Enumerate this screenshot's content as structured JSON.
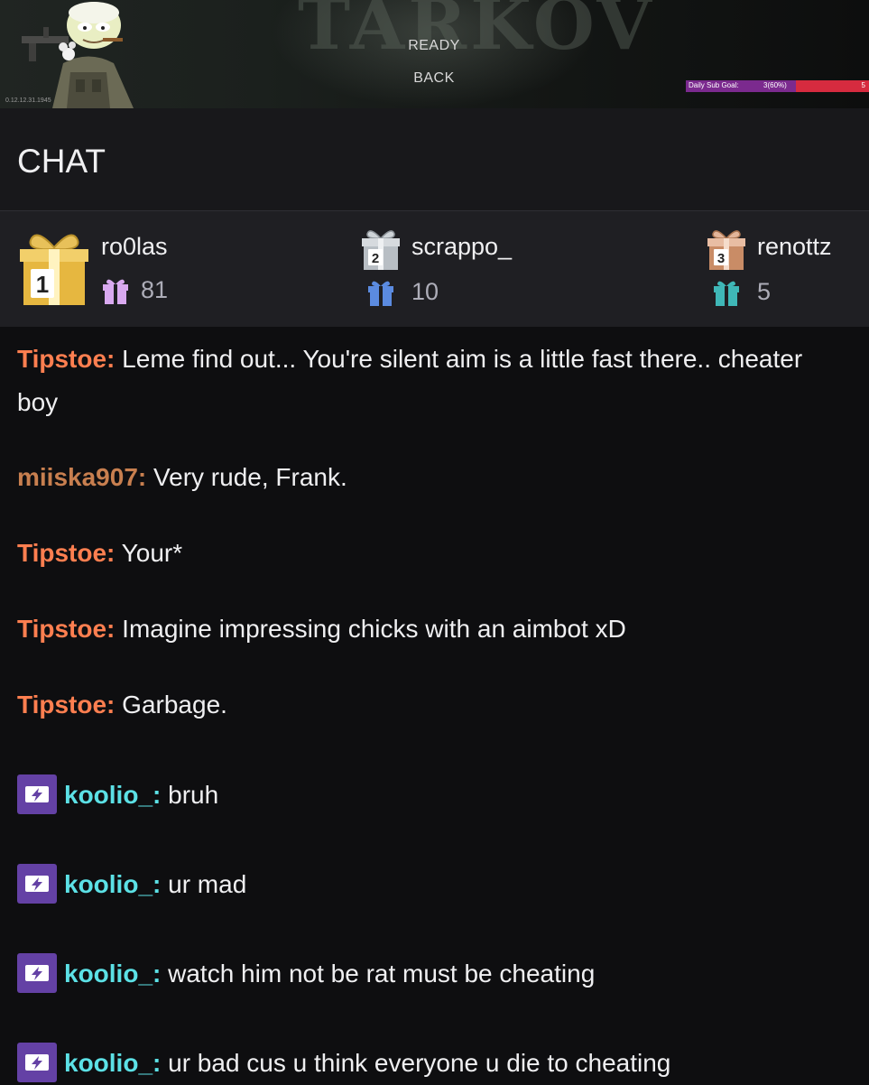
{
  "stream": {
    "menu": [
      "READY",
      "BACK"
    ],
    "version": "0.12.12.31.1945",
    "sub_goal": {
      "label": "Daily Sub Goal:",
      "current": "3(60%)",
      "target": "5",
      "progress": 0.6
    }
  },
  "chat": {
    "title": "CHAT"
  },
  "leaderboard": [
    {
      "rank": "1",
      "name": "ro0las",
      "count": "81",
      "gift_color": "#d9a9f0"
    },
    {
      "rank": "2",
      "name": "scrappo_",
      "count": "10",
      "gift_color": "#5b8be0"
    },
    {
      "rank": "3",
      "name": "renottz",
      "count": "5",
      "gift_color": "#3fb7b7"
    }
  ],
  "messages": [
    {
      "user": "Tipstoe:",
      "text": "Leme find out... You're silent aim is a little fast there.. cheater boy",
      "color": "#ff7f50",
      "badge": false
    },
    {
      "user": "miiska907:",
      "text": "Very rude, Frank.",
      "color": "#c87f4f",
      "badge": false
    },
    {
      "user": "Tipstoe:",
      "text": "Your*",
      "color": "#ff7f50",
      "badge": false
    },
    {
      "user": "Tipstoe:",
      "text": "Imagine impressing chicks with an aimbot xD",
      "color": "#ff7f50",
      "badge": false
    },
    {
      "user": "Tipstoe:",
      "text": "Garbage.",
      "color": "#ff7f50",
      "badge": false
    },
    {
      "user": "koolio_:",
      "text": "bruh",
      "color": "#5ce1e6",
      "badge": true
    },
    {
      "user": "koolio_:",
      "text": "ur mad",
      "color": "#5ce1e6",
      "badge": true
    },
    {
      "user": "koolio_:",
      "text": "watch him not be rat must be cheating",
      "color": "#5ce1e6",
      "badge": true
    },
    {
      "user": "koolio_:",
      "text": "ur bad cus u think everyone u die to cheating",
      "color": "#5ce1e6",
      "badge": true
    }
  ],
  "badge_icon": "prime-gaming-icon"
}
